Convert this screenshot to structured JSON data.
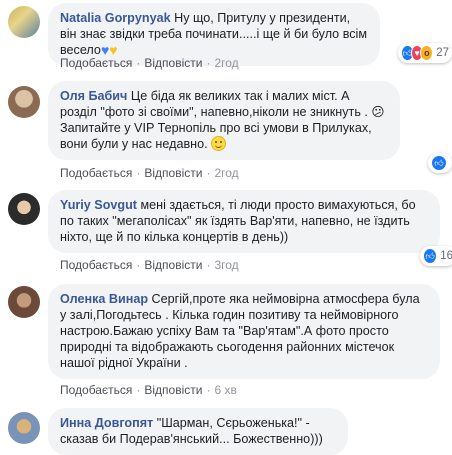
{
  "comments": [
    {
      "author": "Natalia Gorpynyak",
      "text": "Ну що, Притулу у президенти, він знає звідки треба починати.....і ще й би було всім весело",
      "text_emoji": [
        "blue-heart",
        "yellow-heart"
      ],
      "actions": {
        "like": "Подобається",
        "reply": "Відповісти",
        "time": "2год"
      },
      "reactions": {
        "count": "27",
        "types": [
          "like",
          "love",
          "wow"
        ]
      },
      "avatar_colors": [
        "#c8b25a",
        "#5b7fa3"
      ]
    },
    {
      "author": "Оля Бабич",
      "text": "Це біда як великих так і малих міст. А розділ \"фото зі своїми\", напевно,ніколи не зникнуть . 😕 Запитайте у VIP Тернопіль про всі умови в Прилуках, вони були у нас недавно.",
      "text_emoji": [
        "smile"
      ],
      "actions": {
        "like": "Подобається",
        "reply": "Відповісти",
        "time": "2год"
      },
      "reactions": {
        "count": "",
        "types": [
          "like"
        ]
      },
      "avatar_colors": [
        "#8a6a52",
        "#d9c2a6"
      ]
    },
    {
      "author": "Yuriy Sovgut",
      "text": "мені здається, ті люди просто вимахуються, бо по таких \"мегаполісах\" як їздять Вар'яти, напевно, не їздить ніхто, ще й по кілька концертів в день))",
      "actions": {
        "like": "Подобається",
        "reply": "Відповісти",
        "time": "3год"
      },
      "reactions": {
        "count": "16",
        "types": [
          "like"
        ]
      },
      "avatar_colors": [
        "#2b2b2b",
        "#e6c9a8"
      ]
    },
    {
      "author": "Оленка Винар",
      "text": "Сергій,проте яка неймовірна атмосфера була у залі,Погодьтесь . Кілька годин позитиву та неймовірного настрою.Бажаю успіху Вам та \"Вар'ятам\".А фото просто природні та відображають сьогодення районних містечок нашої рідної України .",
      "actions": {
        "like": "Подобається",
        "reply": "Відповісти",
        "time": "6 хв"
      },
      "avatar_colors": [
        "#6b4a3a",
        "#c49a7c"
      ]
    },
    {
      "author": "Инна Довгопят",
      "text": "\"Шарман, Сєрьоженька!\" - сказав би Подерав'янський... Божественно)))",
      "avatar_colors": [
        "#d8b27a",
        "#7a93b8"
      ]
    }
  ]
}
